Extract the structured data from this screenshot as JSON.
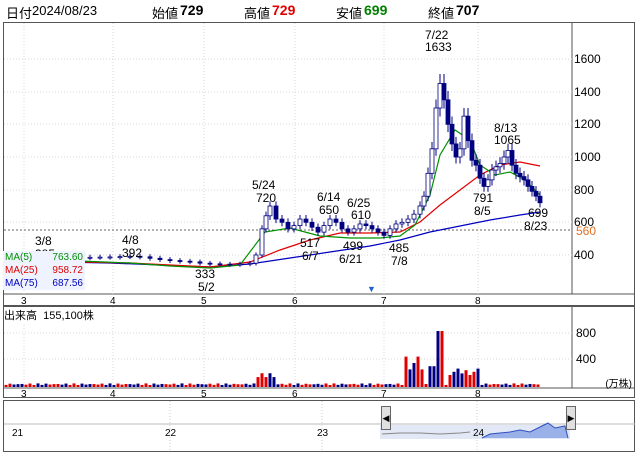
{
  "header": {
    "date_label": "日付",
    "date": "2024/08/23",
    "open_label": "始値",
    "open": "729",
    "high_label": "高値",
    "high": "729",
    "low_label": "安値",
    "low": "699",
    "close_label": "終値",
    "close": "707"
  },
  "colors": {
    "up": "#e00000",
    "down": "#000080",
    "ma5": "#009000",
    "ma25": "#e00000",
    "ma75": "#0000c0",
    "high_color": "#e00000",
    "low_color": "#008000"
  },
  "ma_legend": [
    {
      "label": "MA(5)",
      "value": "763.60"
    },
    {
      "label": "MA(25)",
      "value": "958.72"
    },
    {
      "label": "MA(75)",
      "value": "687.56"
    }
  ],
  "price_axis": [
    "1600",
    "1400",
    "1200",
    "1000",
    "800",
    "600",
    "400"
  ],
  "current_price_label": "560",
  "month_labels": [
    "3",
    "4",
    "5",
    "6",
    "7",
    "8"
  ],
  "volume": {
    "title": "出来高",
    "value": "155,100株",
    "axis": [
      "800",
      "400"
    ],
    "unit": "(万株)"
  },
  "annotations": [
    {
      "text1": "3/8",
      "text2": "385"
    },
    {
      "text1": "4/8",
      "text2": "392"
    },
    {
      "text1": "333",
      "text2": "5/2"
    },
    {
      "text1": "5/24",
      "text2": "720"
    },
    {
      "text1": "517",
      "text2": "6/7"
    },
    {
      "text1": "6/14",
      "text2": "650"
    },
    {
      "text1": "6/25",
      "text2": "610"
    },
    {
      "text1": "499",
      "text2": "6/21"
    },
    {
      "text1": "485",
      "text2": "7/8"
    },
    {
      "text1": "7/22",
      "text2": "1633"
    },
    {
      "text1": "8/13",
      "text2": "1065"
    },
    {
      "text1": "791",
      "text2": "8/5"
    },
    {
      "text1": "699",
      "text2": "8/23"
    }
  ],
  "navigator": {
    "upper_labels": [
      "3",
      "4",
      "5",
      "6",
      "7",
      "8"
    ],
    "lower_labels": [
      "21",
      "22",
      "23",
      "24"
    ],
    "left_arrow": "◀",
    "right_arrow": "▶"
  }
}
